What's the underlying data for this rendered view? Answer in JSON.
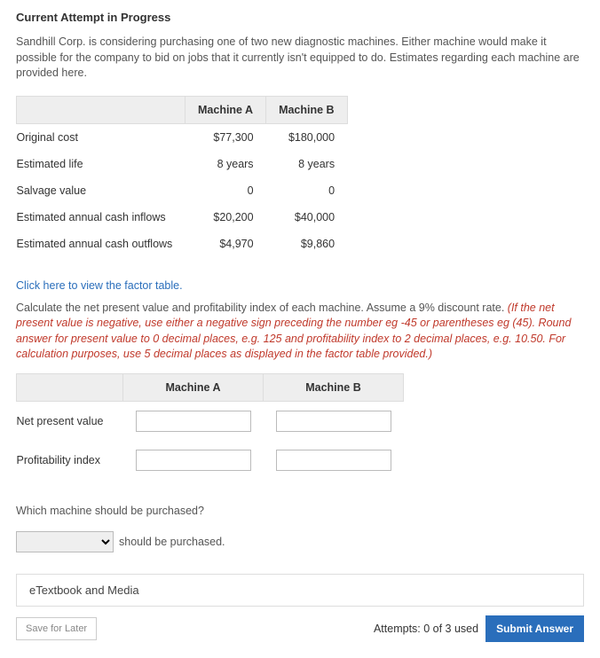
{
  "header": {
    "title": "Current Attempt in Progress"
  },
  "intro": "Sandhill Corp. is considering purchasing one of two new diagnostic machines. Either machine would make it possible for the company to bid on jobs that it currently isn't equipped to do. Estimates regarding each machine are provided here.",
  "data_table": {
    "col_a": "Machine A",
    "col_b": "Machine B",
    "rows": [
      {
        "label": "Original cost",
        "a": "$77,300",
        "b": "$180,000"
      },
      {
        "label": "Estimated life",
        "a": "8 years",
        "b": "8 years"
      },
      {
        "label": "Salvage value",
        "a": "0",
        "b": "0"
      },
      {
        "label": "Estimated annual cash inflows",
        "a": "$20,200",
        "b": "$40,000"
      },
      {
        "label": "Estimated annual cash outflows",
        "a": "$4,970",
        "b": "$9,860"
      }
    ]
  },
  "link_text": "Click here to view the factor table.",
  "instruction_plain": "Calculate the net present value and profitability index of each machine. Assume a 9% discount rate. ",
  "instruction_red": "(If the net present value is negative, use either a negative sign preceding the number eg -45 or parentheses eg (45). Round answer for present value to 0 decimal places, e.g. 125 and profitability index to 2 decimal places, e.g. 10.50. For calculation purposes, use 5 decimal places as displayed in the factor table provided.)",
  "answer": {
    "col_a": "Machine A",
    "col_b": "Machine B",
    "rows": [
      {
        "label": "Net present value"
      },
      {
        "label": "Profitability index"
      }
    ]
  },
  "which_question": "Which machine should be purchased?",
  "should_text": "should be purchased.",
  "etext": "eTextbook and Media",
  "footer": {
    "save": "Save for Later",
    "attempts": "Attempts: 0 of 3 used",
    "submit": "Submit Answer"
  }
}
